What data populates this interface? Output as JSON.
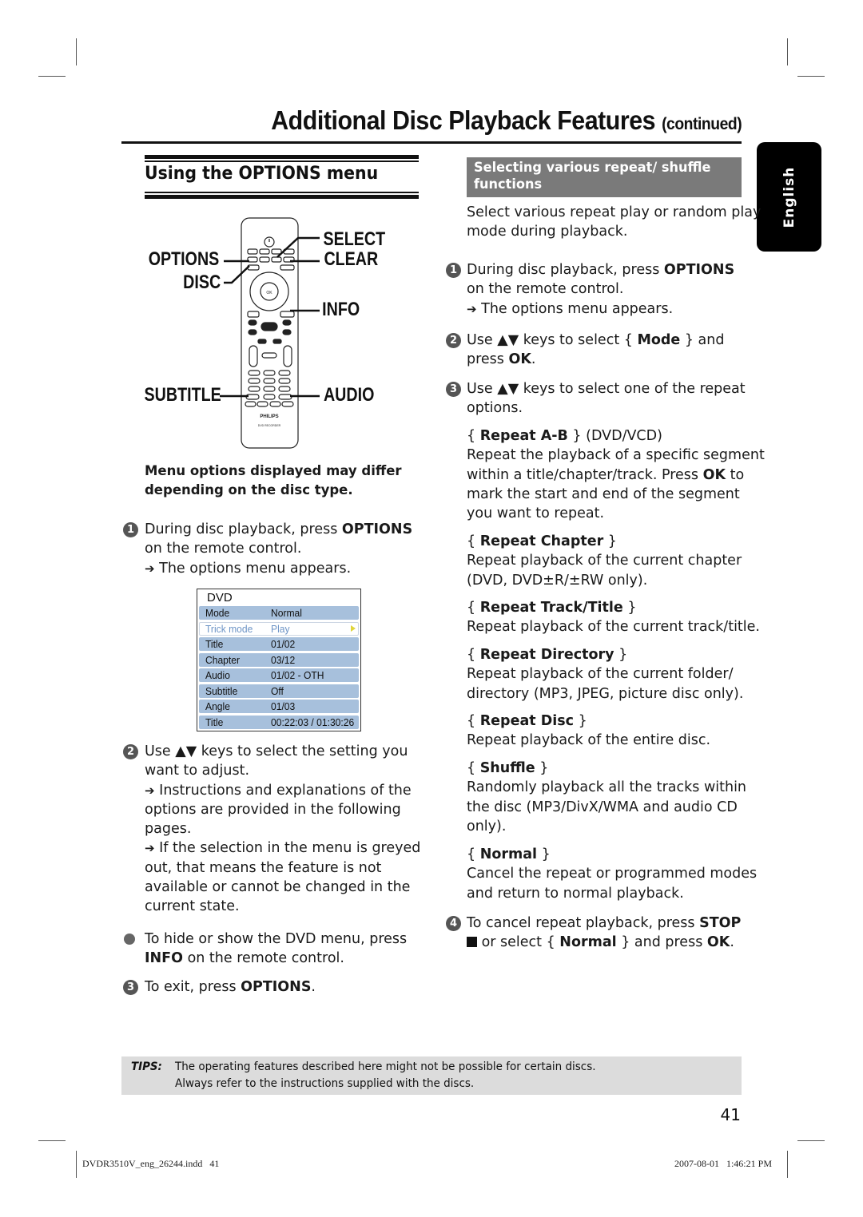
{
  "header": {
    "title": "Additional Disc Playback Features",
    "title_suffix": "(continued)"
  },
  "language_tab": "English",
  "left": {
    "section_title": "Using the OPTIONS menu",
    "remote": {
      "brand": "PHILIPS",
      "model_label": "DVD RECORDER",
      "ok_label": "OK",
      "callouts": {
        "options": "OPTIONS",
        "disc": "DISC",
        "subtitle": "SUBTITLE",
        "select": "SELECT",
        "clear": "CLEAR",
        "info": "INFO",
        "audio": "AUDIO"
      }
    },
    "note": [
      "Menu options displayed may differ",
      "depending on the disc type."
    ],
    "step1": {
      "num": "1",
      "line1_pre": "During disc playback, press ",
      "line1_bold": "OPTIONS",
      "line2": "on the remote control.",
      "result": "The options menu appears."
    },
    "dvd_menu": {
      "header": "DVD",
      "rows": [
        {
          "key": "Mode",
          "value": "Normal",
          "selected": false
        },
        {
          "key": "Trick mode",
          "value": "Play",
          "selected": true
        },
        {
          "key": "Title",
          "value": "01/02",
          "selected": false
        },
        {
          "key": "Chapter",
          "value": "03/12",
          "selected": false
        },
        {
          "key": "Audio",
          "value": "01/02 - OTH",
          "selected": false
        },
        {
          "key": "Subtitle",
          "value": "Off",
          "selected": false
        },
        {
          "key": "Angle",
          "value": "01/03",
          "selected": false
        },
        {
          "key": "Title",
          "value": "00:22:03 / 01:30:26",
          "selected": false
        }
      ]
    },
    "step2": {
      "num": "2",
      "lines": [
        "Use ▲▼ keys to select the setting you",
        "want to adjust."
      ],
      "result1": [
        "Instructions and explanations of the",
        "options are provided in the following",
        "pages."
      ],
      "result2": [
        "If the selection in the menu is greyed",
        "out, that means the feature is not",
        "available or cannot be changed in the",
        "current state."
      ]
    },
    "bullet": {
      "line1": "To hide or show the DVD menu, press",
      "line2_bold": "INFO",
      "line2_rest": " on the remote control."
    },
    "step3": {
      "num": "3",
      "pre": "To exit, press ",
      "bold": "OPTIONS",
      "post": "."
    }
  },
  "right": {
    "section_title_line1": "Selecting various repeat/ shuffle",
    "section_title_line2": "functions",
    "intro": [
      "Select various repeat play or random play",
      "mode during playback."
    ],
    "step1": {
      "num": "1",
      "line1_pre": "During disc playback, press ",
      "line1_bold": "OPTIONS",
      "line2": "on the remote control.",
      "result": "The options menu appears."
    },
    "step2": {
      "num": "2",
      "pre": "Use ▲▼ keys to select { ",
      "bold": "Mode",
      "post": " } and",
      "line2_pre": "press ",
      "line2_bold": "OK",
      "line2_post": "."
    },
    "step3": {
      "num": "3",
      "lines": [
        "Use ▲▼ keys to select one of the repeat",
        "options."
      ]
    },
    "options": [
      {
        "name": "Repeat A-B",
        "suffix": " (DVD/VCD)",
        "desc": [
          "Repeat the playback of a specific segment",
          "within a title/chapter/track. Press |OK| to",
          "mark the start and end of the segment",
          "you want to repeat."
        ]
      },
      {
        "name": "Repeat Chapter",
        "suffix": "",
        "desc": [
          "Repeat playback of the current chapter",
          "(DVD, DVD±R/±RW only)."
        ]
      },
      {
        "name": "Repeat Track/Title",
        "suffix": "",
        "desc": [
          "Repeat playback of the current track/title."
        ]
      },
      {
        "name": "Repeat Directory",
        "suffix": "",
        "desc": [
          "Repeat playback of the current folder/",
          "directory (MP3, JPEG, picture disc only)."
        ]
      },
      {
        "name": "Repeat Disc",
        "suffix": "",
        "desc": [
          "Repeat playback of the entire disc."
        ]
      },
      {
        "name": "Shuffle",
        "suffix": "",
        "desc": [
          "Randomly playback all the tracks within",
          "the disc (MP3/DivX/WMA and audio CD",
          "only)."
        ]
      },
      {
        "name": "Normal",
        "suffix": "",
        "desc": [
          "Cancel the repeat or programmed modes",
          "and return to normal playback."
        ]
      }
    ],
    "step4": {
      "num": "4",
      "line1_pre": "To cancel repeat playback, press ",
      "line1_bold": "STOP",
      "line2_pre": " or select { ",
      "line2_bold": "Normal",
      "line2_mid": " } and press ",
      "line2_bold2": "OK",
      "line2_post": "."
    }
  },
  "tips": {
    "label": "TIPS:",
    "lines": [
      "The operating features described here might not be possible for certain discs.",
      "Always refer to the instructions supplied with the discs."
    ]
  },
  "page_number": "41",
  "slug": {
    "file": "DVDR3510V_eng_26244.indd   41",
    "timestamp": "2007-08-01   1:46:21 PM"
  }
}
